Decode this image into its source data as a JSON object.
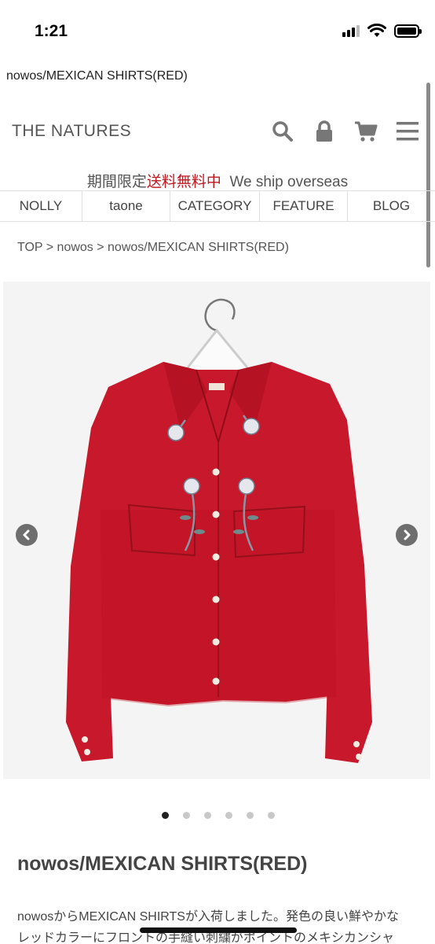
{
  "status_bar": {
    "time": "1:21"
  },
  "browser": {
    "page_title": "nowos/MEXICAN SHIRTS(RED)"
  },
  "header": {
    "logo": "THE NATURES",
    "icons": [
      "search-icon",
      "lock-icon",
      "cart-icon",
      "menu-icon"
    ]
  },
  "notice": {
    "prefix": "期間限定",
    "highlight": "送料無料中",
    "suffix": "We ship overseas",
    "highlight_color": "#c0181f"
  },
  "nav": {
    "items": [
      {
        "label": "NOLLY"
      },
      {
        "label": "taone"
      },
      {
        "label": "CATEGORY"
      },
      {
        "label": "FEATURE"
      },
      {
        "label": "BLOG"
      }
    ]
  },
  "breadcrumb": "TOP > nowos > nowos/MEXICAN SHIRTS(RED)",
  "gallery": {
    "shirt_color": "#c8182b",
    "total_slides": 6,
    "active_slide": 1
  },
  "product": {
    "title": "nowos/MEXICAN SHIRTS(RED)",
    "description_line1": "nowosからMEXICAN SHIRTSが入荷しました。発色の良い鮮やかな",
    "description_line2": "レッドカラーにフロントの手縫い刺繍がポイントのメキシカンシャ"
  }
}
